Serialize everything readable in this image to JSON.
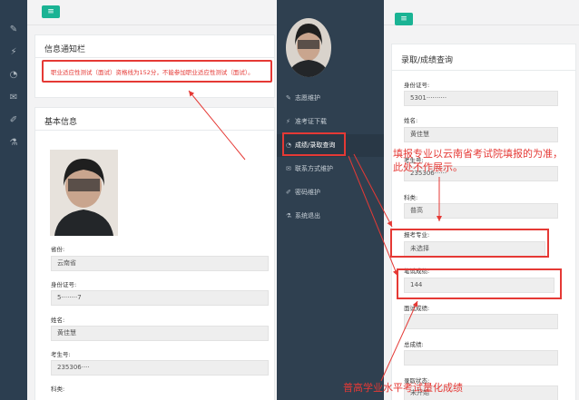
{
  "left_sidebar": {
    "icons": [
      "pencil-icon",
      "flash-icon",
      "pie-icon",
      "mail-icon",
      "edit-icon",
      "flask-icon"
    ]
  },
  "notice": {
    "title": "信息通知栏",
    "message": "职业适应性测试（面试）资格线为152分，不能参加职业适应性测试（面试）。"
  },
  "basic_info": {
    "title": "基本信息",
    "fields": [
      {
        "label": "省份:",
        "value": "云南省"
      },
      {
        "label": "身份证号:",
        "value": "5········7"
      },
      {
        "label": "姓名:",
        "value": "黄佳慧"
      },
      {
        "label": "考生号:",
        "value": "235306····"
      },
      {
        "label": "科类:",
        "value": ""
      }
    ]
  },
  "nav": {
    "items": [
      {
        "label": "志愿维护",
        "icon": "pencil-icon"
      },
      {
        "label": "准考证下载",
        "icon": "flash-icon"
      },
      {
        "label": "成绩/录取查询",
        "icon": "pie-icon"
      },
      {
        "label": "联系方式维护",
        "icon": "mail-icon"
      },
      {
        "label": "密码维护",
        "icon": "edit-icon"
      },
      {
        "label": "系统退出",
        "icon": "flask-icon"
      }
    ]
  },
  "query": {
    "title": "录取/成绩查询",
    "fields": [
      {
        "label": "身份证号:",
        "value": "5301··········"
      },
      {
        "label": "姓名:",
        "value": "黄佳慧"
      },
      {
        "label": "考生号:",
        "value": "235306······"
      },
      {
        "label": "科类:",
        "value": "普高"
      },
      {
        "label": "报考专业:",
        "value": "未选择"
      },
      {
        "label": "笔试成绩:",
        "value": "144"
      },
      {
        "label": "面试成绩:",
        "value": ""
      },
      {
        "label": "总成绩:",
        "value": ""
      },
      {
        "label": "录取状态:",
        "value": "未开始"
      }
    ]
  },
  "annotations": {
    "major_note_line1": "填报专业以云南省考试院填报的为准，",
    "major_note_line2": "此处不作展示。",
    "score_note": "普高学业水平考试量化成绩"
  },
  "colors": {
    "accent": "#1ab394",
    "sidebar": "#2f4050",
    "annotation_red": "#e53935"
  }
}
